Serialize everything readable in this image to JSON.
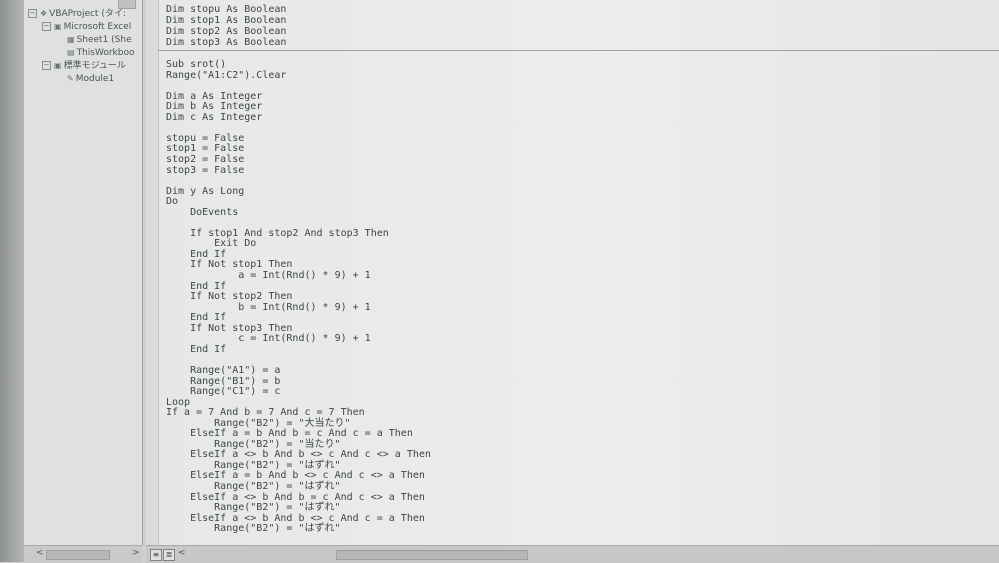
{
  "project_tree": [
    {
      "label": "VBAProject (タイ:",
      "icon": "vba-project-icon",
      "expander": "⊟",
      "level": 0
    },
    {
      "label": "Microsoft Excel",
      "icon": "folder-icon",
      "expander": "⊟",
      "level": 1
    },
    {
      "label": "Sheet1 (She",
      "icon": "sheet-icon",
      "expander": "",
      "level": 2
    },
    {
      "label": "ThisWorkboo",
      "icon": "workbook-icon",
      "expander": "",
      "level": 2
    },
    {
      "label": "標準モジュール",
      "icon": "folder-icon",
      "expander": "⊟",
      "level": 1
    },
    {
      "label": "Module1",
      "icon": "module-icon",
      "expander": "",
      "level": 2
    }
  ],
  "declarations": [
    "Dim stopu As Boolean",
    "Dim stop1 As Boolean",
    "Dim stop2 As Boolean",
    "Dim stop3 As Boolean"
  ],
  "code_lines": [
    {
      "i": 0,
      "t": "Sub srot()"
    },
    {
      "i": 0,
      "t": "Range(\"A1:C2\").Clear"
    },
    {
      "i": 0,
      "t": ""
    },
    {
      "i": 0,
      "t": "Dim a As Integer"
    },
    {
      "i": 0,
      "t": "Dim b As Integer"
    },
    {
      "i": 0,
      "t": "Dim c As Integer"
    },
    {
      "i": 0,
      "t": ""
    },
    {
      "i": 0,
      "t": "stopu = False"
    },
    {
      "i": 0,
      "t": "stop1 = False"
    },
    {
      "i": 0,
      "t": "stop2 = False"
    },
    {
      "i": 0,
      "t": "stop3 = False"
    },
    {
      "i": 0,
      "t": ""
    },
    {
      "i": 0,
      "t": "Dim y As Long"
    },
    {
      "i": 0,
      "t": "Do"
    },
    {
      "i": 4,
      "t": "DoEvents"
    },
    {
      "i": 0,
      "t": ""
    },
    {
      "i": 4,
      "t": "If stop1 And stop2 And stop3 Then"
    },
    {
      "i": 8,
      "t": "Exit Do"
    },
    {
      "i": 4,
      "t": "End If"
    },
    {
      "i": 4,
      "t": "If Not stop1 Then"
    },
    {
      "i": 12,
      "t": "a = Int(Rnd() * 9) + 1"
    },
    {
      "i": 4,
      "t": "End If"
    },
    {
      "i": 4,
      "t": "If Not stop2 Then"
    },
    {
      "i": 12,
      "t": "b = Int(Rnd() * 9) + 1"
    },
    {
      "i": 4,
      "t": "End If"
    },
    {
      "i": 4,
      "t": "If Not stop3 Then"
    },
    {
      "i": 12,
      "t": "c = Int(Rnd() * 9) + 1"
    },
    {
      "i": 4,
      "t": "End If"
    },
    {
      "i": 0,
      "t": ""
    },
    {
      "i": 4,
      "t": "Range(\"A1\") = a"
    },
    {
      "i": 4,
      "t": "Range(\"B1\") = b"
    },
    {
      "i": 4,
      "t": "Range(\"C1\") = c"
    },
    {
      "i": 0,
      "t": "Loop"
    },
    {
      "i": 0,
      "t": "If a = 7 And b = 7 And c = 7 Then"
    },
    {
      "i": 8,
      "t": "Range(\"B2\") = \"大当たり\""
    },
    {
      "i": 4,
      "t": "ElseIf a = b And b = c And c = a Then"
    },
    {
      "i": 8,
      "t": "Range(\"B2\") = \"当たり\""
    },
    {
      "i": 4,
      "t": "ElseIf a <> b And b <> c And c <> a Then"
    },
    {
      "i": 8,
      "t": "Range(\"B2\") = \"はずれ\""
    },
    {
      "i": 4,
      "t": "ElseIf a = b And b <> c And c <> a Then"
    },
    {
      "i": 8,
      "t": "Range(\"B2\") = \"はずれ\""
    },
    {
      "i": 4,
      "t": "ElseIf a <> b And b = c And c <> a Then"
    },
    {
      "i": 8,
      "t": "Range(\"B2\") = \"はずれ\""
    },
    {
      "i": 4,
      "t": "ElseIf a <> b And b <> c And c = a Then"
    },
    {
      "i": 8,
      "t": "Range(\"B2\") = \"はずれ\""
    }
  ],
  "status": {
    "view_procedure_icon": "≡",
    "view_module_icon": "≣",
    "scroll_left": "<",
    "scroll_right": ">"
  }
}
